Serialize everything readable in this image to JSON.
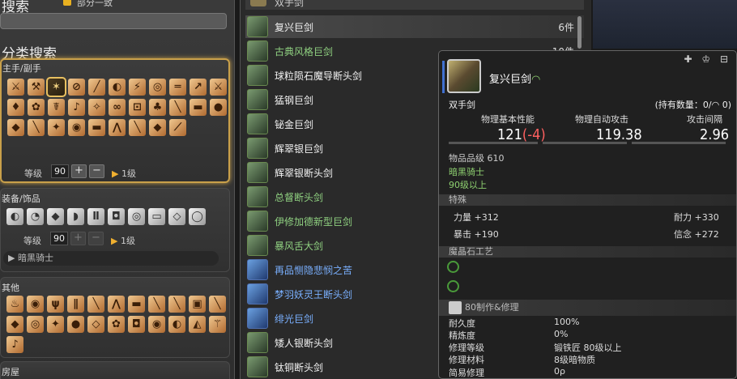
{
  "left": {
    "search_title": "搜索",
    "checkbox_label": "部分一致",
    "category_title": "分类搜索",
    "main_panel_label": "主手/副手",
    "main_icons": [
      "⚔",
      "⚒",
      "✶",
      "⊘",
      "╱",
      "◐",
      "⚡",
      "◎",
      "═",
      "↗",
      "⚔",
      "♦",
      "✿",
      "☤",
      "♪",
      "✧",
      "∞",
      "⊡",
      "♣",
      "╲",
      "▬",
      "●",
      "◆",
      "╲",
      "✦",
      "◉",
      "▬",
      "⋀",
      "╲",
      "◆",
      "⟋"
    ],
    "level_label": "等级",
    "level_value": "90",
    "plus": "+",
    "minus": "−",
    "level_tri": "▶",
    "level_text": "1级",
    "equip_panel_label": "装备/饰品",
    "equip_icons": [
      "◐",
      "◔",
      "◆",
      "◗",
      "Ⅱ",
      "◘",
      "◎",
      "▭",
      "◇",
      "◯"
    ],
    "equip_level_value": "90",
    "job_dropdown": "▶ 暗黑骑士",
    "other_panel_label": "其他",
    "other_icons": [
      "♨",
      "◉",
      "ψ",
      "∥",
      "╲",
      "⋀",
      "▬",
      "╲",
      "╲",
      "▣",
      "╲",
      "◆",
      "◎",
      "✦",
      "●",
      "◇",
      "✿",
      "◘",
      "◉",
      "◐",
      "◭",
      "⚚",
      "♪"
    ],
    "housing_label": "房屋"
  },
  "list": {
    "header_label": "双手剑",
    "rows": [
      {
        "name": "复兴巨剑",
        "count": "6件",
        "color": "g1",
        "icon": "g"
      },
      {
        "name": "古典风格巨剑",
        "count": "10件",
        "color": "g2",
        "icon": "g"
      },
      {
        "name": "球粒陨石魔导断头剑",
        "count": "",
        "color": "g1",
        "icon": "g"
      },
      {
        "name": "猛钢巨剑",
        "count": "",
        "color": "g1",
        "icon": "g"
      },
      {
        "name": "铋金巨剑",
        "count": "",
        "color": "g1",
        "icon": "g"
      },
      {
        "name": "辉翠银巨剑",
        "count": "",
        "color": "g1",
        "icon": "g"
      },
      {
        "name": "辉翠银断头剑",
        "count": "",
        "color": "g1",
        "icon": "g"
      },
      {
        "name": "总督断头剑",
        "count": "",
        "color": "g2",
        "icon": "g"
      },
      {
        "name": "伊修加德新型巨剑",
        "count": "",
        "color": "g2",
        "icon": "g"
      },
      {
        "name": "暴风舌大剑",
        "count": "",
        "color": "g2",
        "icon": "g"
      },
      {
        "name": "再品恻隐悲悯之苦",
        "count": "",
        "color": "g3",
        "icon": "b"
      },
      {
        "name": "梦羽妖灵王断头剑",
        "count": "",
        "color": "g3",
        "icon": "b"
      },
      {
        "name": "绯光巨剑",
        "count": "",
        "color": "g3",
        "icon": "b"
      },
      {
        "name": "矮人银断头剑",
        "count": "",
        "color": "g1",
        "icon": "g"
      },
      {
        "name": "钛铜断头剑",
        "count": "",
        "color": "g1",
        "icon": "g"
      }
    ]
  },
  "tooltip": {
    "name": "复兴巨剑",
    "hq_mark": "◠",
    "buttons": "✚ ♔ ⊟",
    "type": "双手剑",
    "owned": "(持有数量：0/◠ 0)",
    "stat_headers": [
      "物理基本性能",
      "物理自动攻击",
      "攻击间隔"
    ],
    "stat_values": [
      "121",
      "119.38",
      "2.96"
    ],
    "stat_diff": "(-4)",
    "item_level": "物品品级 610",
    "job": "暗黑骑士",
    "req_level": "90级以上",
    "special_label": "特殊",
    "stats": [
      {
        "name": "力量",
        "value": "+312"
      },
      {
        "name": "耐力",
        "value": "+330"
      },
      {
        "name": "暴击",
        "value": "+190"
      },
      {
        "name": "信念",
        "value": "+272"
      }
    ],
    "materia_label": "魔晶石工艺",
    "craft_label": "80制作&修理",
    "craft": [
      {
        "k": "耐久度",
        "v": "100%"
      },
      {
        "k": "精炼度",
        "v": "0%"
      },
      {
        "k": "修理等级",
        "v": "锻铁匠 80级以上"
      },
      {
        "k": "修理材料",
        "v": "8级暗物质"
      },
      {
        "k": "简易修理",
        "v": "0ρ"
      }
    ]
  }
}
